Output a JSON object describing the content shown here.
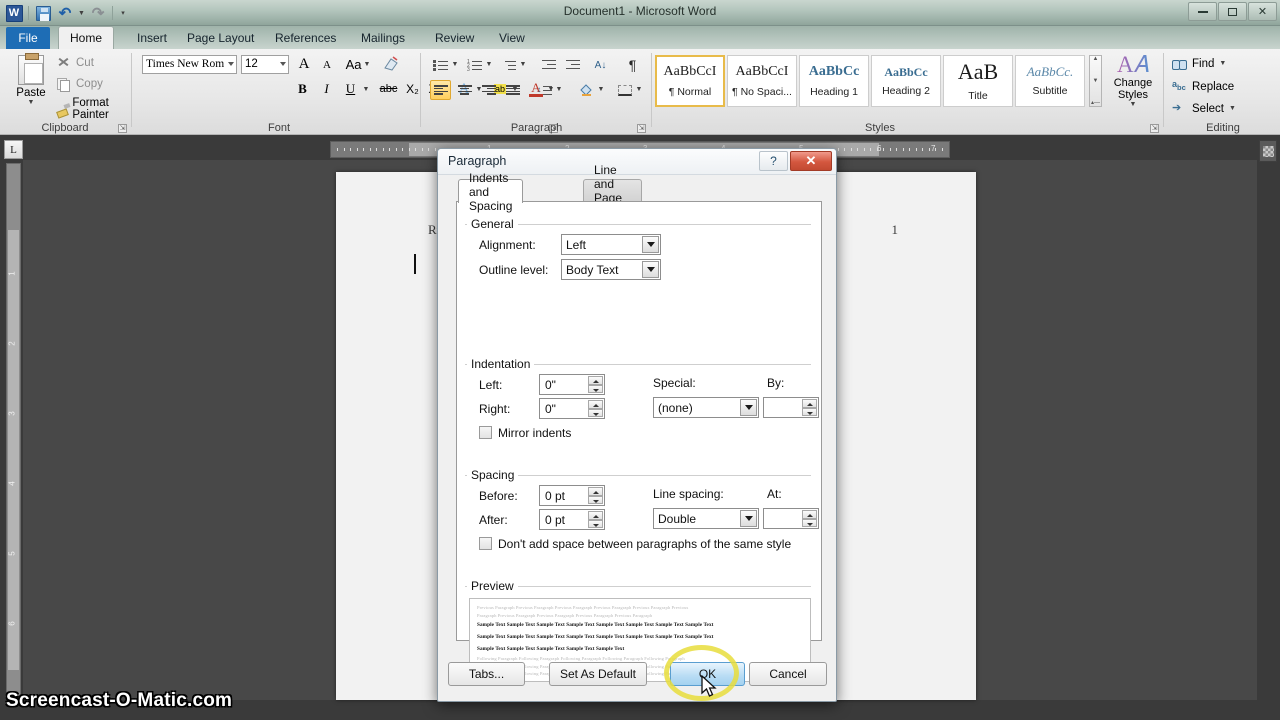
{
  "titlebar": {
    "document_title": "Document1  -  Microsoft Word",
    "quick_access": [
      {
        "name": "word-logo",
        "label": "W"
      },
      {
        "name": "save",
        "label": "Save"
      },
      {
        "name": "undo",
        "label": "Undo"
      },
      {
        "name": "redo",
        "label": "Redo"
      },
      {
        "name": "customize",
        "label": "Customize Quick Access Toolbar"
      }
    ],
    "window_controls": [
      "Minimize",
      "Restore Down",
      "Close"
    ],
    "help": "?"
  },
  "tabs": [
    {
      "label": "File"
    },
    {
      "label": "Home"
    },
    {
      "label": "Insert"
    },
    {
      "label": "Page Layout"
    },
    {
      "label": "References"
    },
    {
      "label": "Mailings"
    },
    {
      "label": "Review"
    },
    {
      "label": "View"
    }
  ],
  "ribbon": {
    "clipboard": {
      "name": "Clipboard",
      "paste": "Paste",
      "cut": "Cut",
      "copy": "Copy",
      "format_painter": "Format Painter"
    },
    "font": {
      "name": "Font",
      "font_name": "Times New Rom",
      "font_size": "12",
      "grow": "A",
      "shrink": "A",
      "change_case": "Aa",
      "clear_formatting": "Clear Formatting",
      "bold": "B",
      "italic": "I",
      "underline": "U",
      "strikethrough": "abc",
      "subscript": "X₂",
      "superscript": "X²",
      "text_effects": "A",
      "highlight": "ab",
      "font_color": "A"
    },
    "paragraph": {
      "name": "Paragraph",
      "bullets": "Bullets",
      "numbering": "Numbering",
      "multilevel": "Multilevel List",
      "decrease_indent": "Decrease Indent",
      "increase_indent": "Increase Indent",
      "sort": "Sort",
      "show_marks": "¶",
      "align_left": "Align Text Left",
      "align_center": "Center",
      "align_right": "Align Text Right",
      "justify": "Justify",
      "line_spacing": "Line and Paragraph Spacing",
      "shading": "Shading",
      "borders": "Borders"
    },
    "styles": {
      "name": "Styles",
      "items": [
        {
          "preview": "AaBbCcI",
          "label": "¶ Normal",
          "selected": true
        },
        {
          "preview": "AaBbCcI",
          "label": "¶ No Spaci...",
          "selected": false
        },
        {
          "preview": "AaBbCс",
          "label": "Heading 1",
          "selected": false
        },
        {
          "preview": "AaBbCc",
          "label": "Heading 2",
          "selected": false
        },
        {
          "preview": "AaB",
          "label": "Title",
          "selected": false
        },
        {
          "preview": "AaBbCc.",
          "label": "Subtitle",
          "selected": false
        }
      ],
      "change_styles": "Change Styles"
    },
    "editing": {
      "name": "Editing",
      "find": "Find",
      "replace": "Replace",
      "select": "Select"
    }
  },
  "ruler": {
    "tab_selector": "L",
    "horizontal_numbers": [
      "1",
      "2",
      "3",
      "4",
      "5",
      "6",
      "7"
    ],
    "vertical_numbers": [
      "1",
      "2",
      "3",
      "4",
      "5",
      "6"
    ]
  },
  "document": {
    "running_head": "Runn",
    "page_number": "1"
  },
  "dialog": {
    "title": "Paragraph",
    "help_button": "?",
    "close_button": "✕",
    "tabs": [
      {
        "label": "Indents and Spacing",
        "selected": true
      },
      {
        "label": "Line and Page Breaks",
        "selected": false
      }
    ],
    "general": {
      "legend": "General",
      "alignment_label": "Alignment:",
      "alignment_value": "Left",
      "outline_label": "Outline level:",
      "outline_value": "Body Text"
    },
    "indentation": {
      "legend": "Indentation",
      "left_label": "Left:",
      "left_value": "0\"",
      "right_label": "Right:",
      "right_value": "0\"",
      "special_label": "Special:",
      "special_value": "(none)",
      "by_label": "By:",
      "by_value": "",
      "mirror_label": "Mirror indents",
      "mirror_checked": false
    },
    "spacing": {
      "legend": "Spacing",
      "before_label": "Before:",
      "before_value": "0 pt",
      "after_label": "After:",
      "after_value": "0 pt",
      "line_spacing_label": "Line spacing:",
      "line_spacing_value": "Double",
      "at_label": "At:",
      "at_value": "",
      "dont_add_label": "Don't add space between paragraphs of the same style",
      "dont_add_checked": false
    },
    "preview": {
      "legend": "Preview",
      "previous_lines": [
        "Previous Paragraph Previous Paragraph Previous Paragraph Previous Paragraph Previous Paragraph Previous",
        "Paragraph Previous Paragraph Previous Paragraph Previous Paragraph Previous Paragraph"
      ],
      "sample_lines": [
        "Sample Text Sample Text Sample Text Sample Text Sample Text Sample Text Sample Text Sample Text",
        "Sample Text Sample Text Sample Text Sample Text Sample Text Sample Text Sample Text Sample Text",
        "Sample Text Sample Text Sample Text Sample Text Sample Text"
      ],
      "following_lines": [
        "Following Paragraph Following Paragraph Following Paragraph Following Paragraph Following Paragraph",
        "Following Paragraph Following Paragraph Following Paragraph Following Paragraph Following Paragraph",
        "Following Paragraph Following Paragraph Following Paragraph Following Paragraph Following Paragraph"
      ]
    },
    "buttons": {
      "tabs": "Tabs...",
      "set_as_default": "Set As Default",
      "ok": "OK",
      "cancel": "Cancel"
    }
  },
  "watermark": "Screencast-O-Matic.com",
  "colors": {
    "file_tab": "#1e6db5",
    "dialog_close": "#c24a32",
    "highlight_ring": "#e8dd3c",
    "style_selected": "#e8bb4a",
    "ok_hover": "#a4d2f0"
  }
}
